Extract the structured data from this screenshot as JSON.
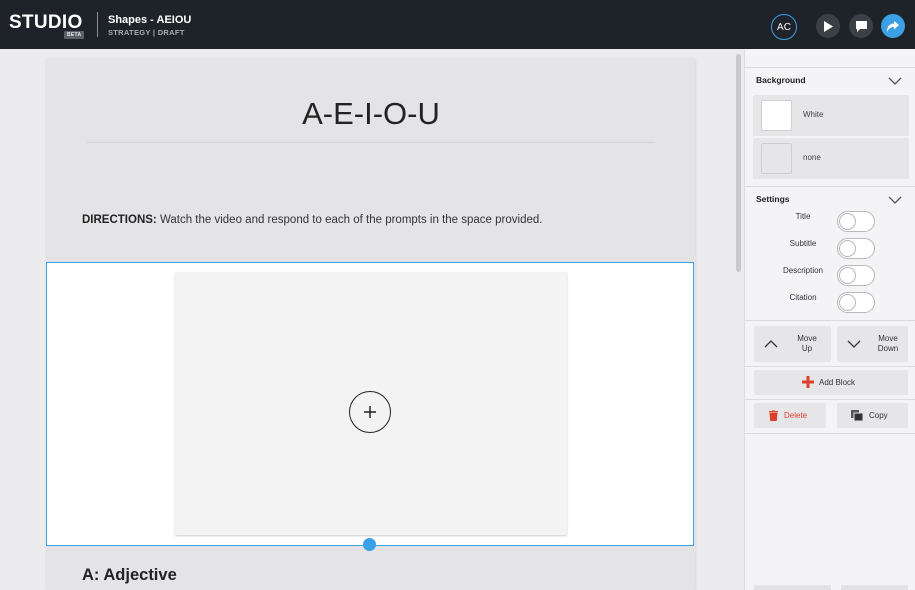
{
  "header": {
    "logo": "STUDIO",
    "beta": "BETA",
    "title": "Shapes - AEIOU",
    "subtitle": "STRATEGY | DRAFT",
    "avatar_initials": "AC",
    "icons": {
      "play": "play-icon",
      "comment": "comment-icon",
      "share": "share-icon"
    }
  },
  "page": {
    "title": "A-E-I-O-U",
    "directions_label": "DIRECTIONS:",
    "directions_text": " Watch the video and respond to each of the prompts in the space provided.",
    "section_title": "A: Adjective"
  },
  "sidebar": {
    "background": {
      "header": "Background",
      "options": [
        {
          "label": "White"
        },
        {
          "label": "none"
        }
      ]
    },
    "settings": {
      "header": "Settings",
      "items": [
        {
          "label": "Title",
          "enabled": false
        },
        {
          "label": "Subtitle",
          "enabled": false
        },
        {
          "label": "Description",
          "enabled": false
        },
        {
          "label": "Citation",
          "enabled": false
        }
      ]
    },
    "move_up_line1": "Move",
    "move_up_line2": "Up",
    "move_down_line1": "Move",
    "move_down_line2": "Down",
    "add_block": "Add Block",
    "delete": "Delete",
    "copy": "Copy"
  },
  "colors": {
    "accent": "#3ba0e6",
    "header_bg": "#1e2229",
    "danger": "#d9412b"
  }
}
